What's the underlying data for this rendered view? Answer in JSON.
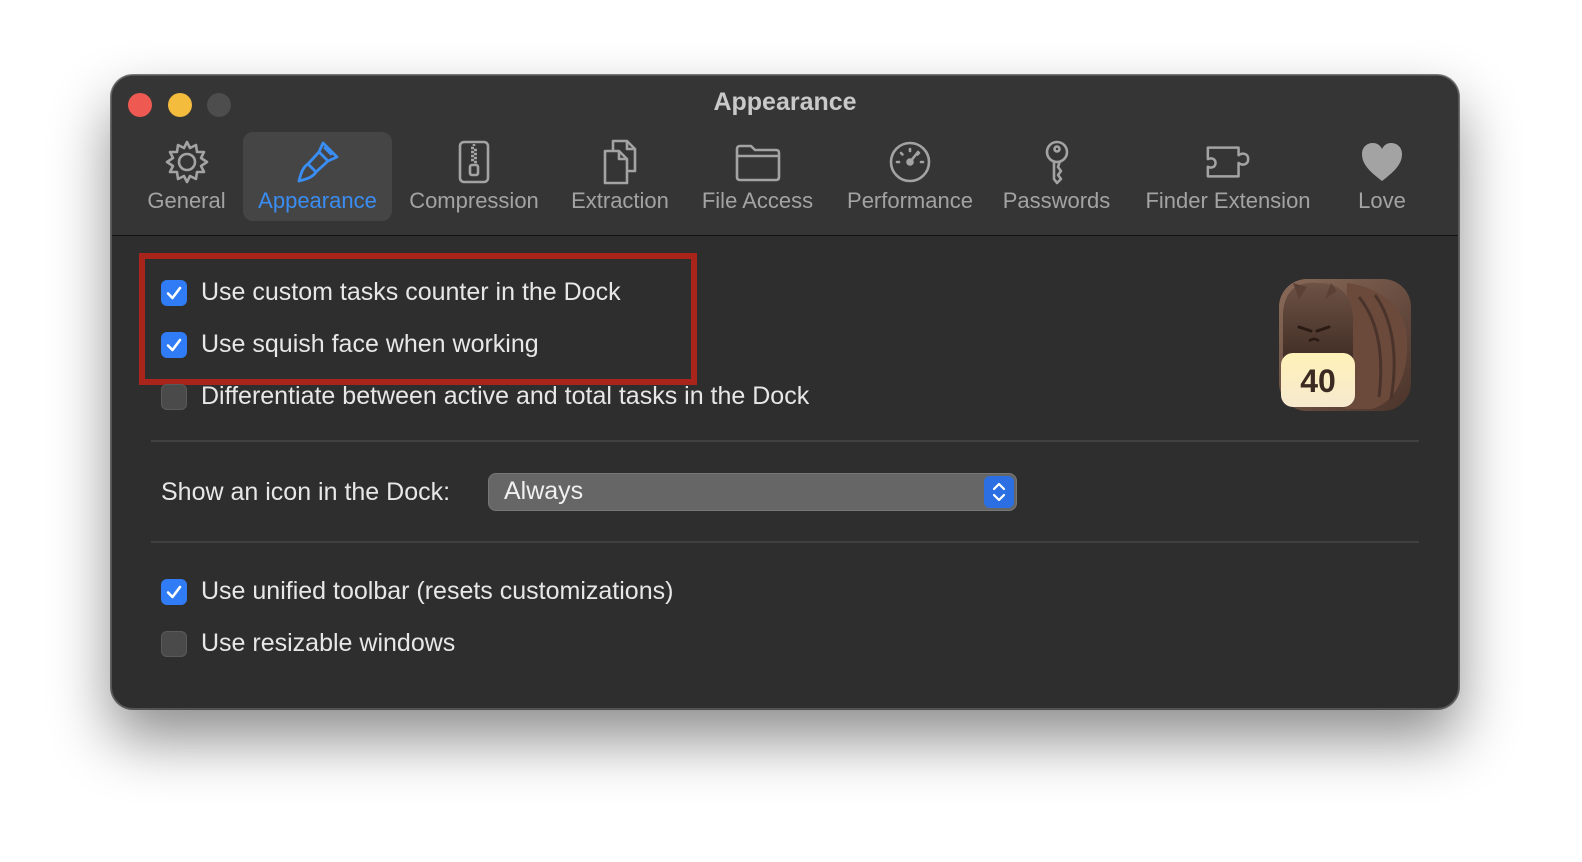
{
  "window": {
    "title": "Appearance"
  },
  "toolbar": {
    "tabs": [
      {
        "label": "General",
        "icon": "gear-icon"
      },
      {
        "label": "Appearance",
        "icon": "paintbrush-icon",
        "active": true
      },
      {
        "label": "Compression",
        "icon": "zipper-file-icon"
      },
      {
        "label": "Extraction",
        "icon": "documents-icon"
      },
      {
        "label": "File Access",
        "icon": "folder-icon"
      },
      {
        "label": "Performance",
        "icon": "gauge-icon"
      },
      {
        "label": "Passwords",
        "icon": "key-icon"
      },
      {
        "label": "Finder Extension",
        "icon": "puzzle-icon"
      },
      {
        "label": "Love",
        "icon": "heart-icon"
      }
    ]
  },
  "options": {
    "custom_counter": {
      "label": "Use custom tasks counter in the Dock",
      "checked": true
    },
    "squish_face": {
      "label": "Use squish face when working",
      "checked": true
    },
    "differentiate": {
      "label": "Differentiate between active and total tasks in the Dock",
      "checked": false
    },
    "dock_icon": {
      "label": "Show an icon in the Dock:",
      "value": "Always"
    },
    "unified_toolbar": {
      "label": "Use unified toolbar (resets customizations)",
      "checked": true
    },
    "resizable_windows": {
      "label": "Use resizable windows",
      "checked": false
    }
  },
  "dock_badge": {
    "count": "40"
  },
  "colors": {
    "accent": "#2f7cf6",
    "highlight": "#a9241a",
    "window_bg": "#2e2e2e"
  }
}
